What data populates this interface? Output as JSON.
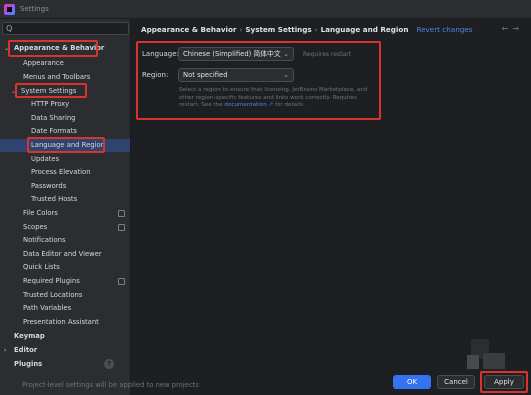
{
  "window": {
    "title": "Settings"
  },
  "search": {
    "placeholder": "Q"
  },
  "sidebar": {
    "items": [
      {
        "label": "Appearance & Behavior"
      },
      {
        "label": "Appearance"
      },
      {
        "label": "Menus and Toolbars"
      },
      {
        "label": "System Settings"
      },
      {
        "label": "HTTP Proxy"
      },
      {
        "label": "Data Sharing"
      },
      {
        "label": "Date Formats"
      },
      {
        "label": "Language and Region"
      },
      {
        "label": "Updates"
      },
      {
        "label": "Process Elevation"
      },
      {
        "label": "Passwords"
      },
      {
        "label": "Trusted Hosts"
      },
      {
        "label": "File Colors"
      },
      {
        "label": "Scopes"
      },
      {
        "label": "Notifications"
      },
      {
        "label": "Data Editor and Viewer"
      },
      {
        "label": "Quick Lists"
      },
      {
        "label": "Required Plugins"
      },
      {
        "label": "Trusted Locations"
      },
      {
        "label": "Path Variables"
      },
      {
        "label": "Presentation Assistant"
      },
      {
        "label": "Keymap"
      },
      {
        "label": "Editor"
      },
      {
        "label": "Plugins"
      }
    ]
  },
  "header": {
    "crumb1": "Appearance & Behavior",
    "crumb2": "System Settings",
    "crumb3": "Language and Region",
    "separator": "›",
    "revert": "Revert changes",
    "back_icon": "←",
    "forward_icon": "→"
  },
  "content": {
    "language_label": "Language:",
    "language_value": "Chinese (Simplified) 简体中文",
    "restart_hint": "Requires restart",
    "region_label": "Region:",
    "region_value": "Not specified",
    "desc_line1": "Select a region to ensure that licensing, JetBrains Marketplace, and",
    "desc_line2": "other region-specific features and links work correctly. Requires",
    "desc_pre": "restart. See the",
    "desc_link": "documentation ↗",
    "desc_post": "for details."
  },
  "footer": {
    "note": "Project-level settings will be applied to new projects",
    "help": "?",
    "ok": "OK",
    "cancel": "Cancel",
    "apply": "Apply"
  },
  "colors": {
    "accent": "#3574f0",
    "highlight_border": "#d9342b",
    "selection": "#2e436e",
    "link": "#4c86e5"
  },
  "icons": [
    "search-icon",
    "chevron-down-icon",
    "chevron-right-icon",
    "project-scope-icon",
    "help-icon",
    "back-arrow-icon",
    "forward-arrow-icon"
  ]
}
